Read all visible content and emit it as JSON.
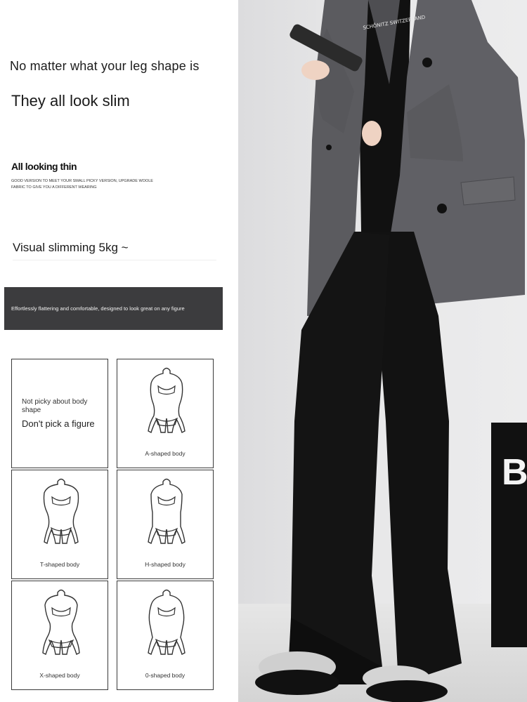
{
  "left": {
    "headline": "No matter what your leg shape is",
    "subhead": "They all look slim",
    "small_title": "All looking thin",
    "small_caption": "GOOD VERSION TO MEET YOUR SMALL PICKY VERSION, UPGRADE WOOLE FABRIC TO GIVE YOU A DIFFERENT WEARING",
    "slim_text": "Visual slimming 5kg ~",
    "banner_text": "Effortlessly flattering and comfortable, designed to look great on any figure"
  },
  "grid": {
    "intro_small": "Not picky about body shape",
    "intro_big": "Don't pick a figure",
    "bodies": [
      {
        "label": "A-shaped body"
      },
      {
        "label": "T-shaped body"
      },
      {
        "label": "H-shaped body"
      },
      {
        "label": "X-shaped body"
      },
      {
        "label": "0-shaped body"
      }
    ]
  },
  "photo": {
    "shirt_text": "SCHÖNITZ SWITZERLAND",
    "bag_letter": "B"
  }
}
